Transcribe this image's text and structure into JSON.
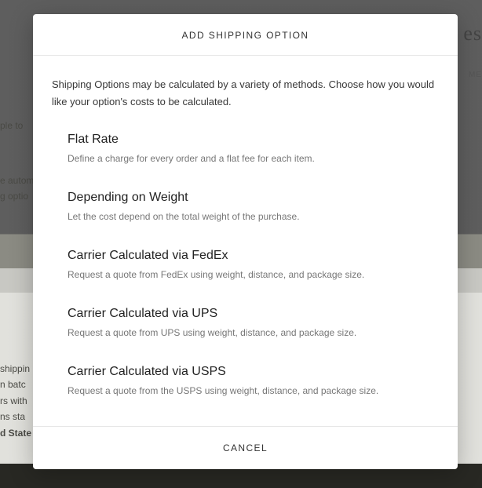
{
  "background": {
    "logo_fragment": "es",
    "text_top": "ple to",
    "text_mid_line1": "e autom",
    "text_mid_line2": "g optio",
    "text_bottom_line1": "shippin",
    "text_bottom_line2": "n batc",
    "text_bottom_line3": "rs with",
    "text_bottom_line4": "ns sta",
    "text_bottom_line5": "d State",
    "text_meta": "ME"
  },
  "modal": {
    "title": "ADD SHIPPING OPTION",
    "intro": "Shipping Options may be calculated by a variety of methods. Choose how you would like your option's costs to be calculated.",
    "options": [
      {
        "title": "Flat Rate",
        "desc": "Define a charge for every order and a flat fee for each item."
      },
      {
        "title": "Depending on Weight",
        "desc": "Let the cost depend on the total weight of the purchase."
      },
      {
        "title": "Carrier Calculated via FedEx",
        "desc": "Request a quote from FedEx using weight, distance, and package size."
      },
      {
        "title": "Carrier Calculated via UPS",
        "desc": "Request a quote from UPS using weight, distance, and package size."
      },
      {
        "title": "Carrier Calculated via USPS",
        "desc": "Request a quote from the USPS using weight, distance, and package size."
      }
    ],
    "cancel_label": "CANCEL"
  }
}
